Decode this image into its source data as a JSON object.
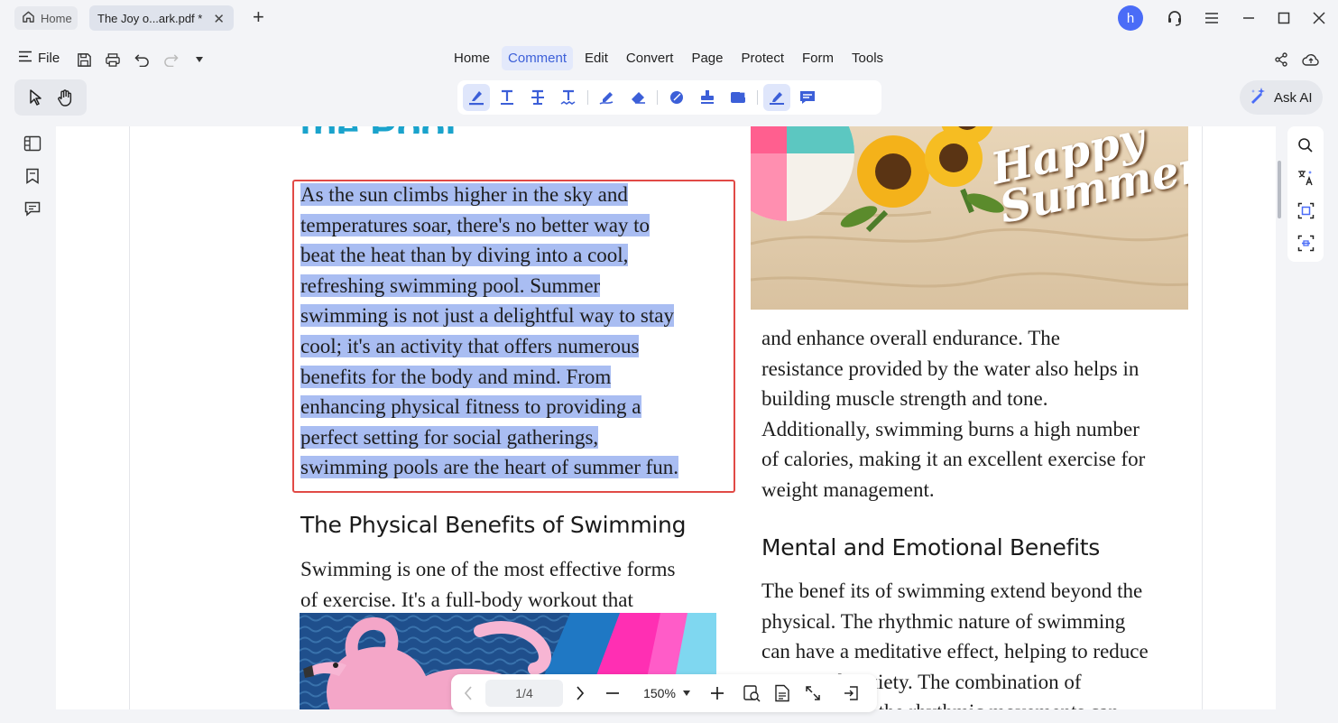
{
  "tabs": {
    "home_label": "Home",
    "doc_label": "The Joy o...ark.pdf *",
    "close_glyph": "✕",
    "new_tab_glyph": "+"
  },
  "user": {
    "avatar_letter": "h"
  },
  "menu": {
    "file_label": "File",
    "items": [
      "Home",
      "Comment",
      "Edit",
      "Convert",
      "Page",
      "Protect",
      "Form",
      "Tools"
    ],
    "active": "Comment"
  },
  "ask_ai": {
    "label": "Ask AI"
  },
  "document": {
    "title_fragment": "the Pool",
    "intro_lines": [
      "As the sun climbs higher in the sky and",
      "temperatures soar, there's no better way to",
      "beat the heat than by diving into a cool,",
      "refreshing swimming pool. Summer",
      "swimming is not just a delightful way to stay",
      "cool; it's an activity that offers numerous",
      "benefits for the body and mind. From",
      "enhancing physical fitness to providing a",
      "perfect setting for social gatherings,",
      "swimming pools are the heart of summer fun."
    ],
    "heading_physical": "The Physical Benefits of Swimming",
    "physical_lines": [
      "Swimming is one of the most effective forms",
      "of exercise. It's a full-body workout that"
    ],
    "endurance_lines": [
      "and enhance overall endurance. The",
      "resistance provided by the water also helps in",
      "building muscle strength and tone.",
      "Additionally, swimming burns a high number",
      "of calories, making it an excellent exercise for",
      "weight management."
    ],
    "heading_mental": "Mental and Emotional Benefits",
    "mental_lines": [
      "The benef  its of swimming extend beyond the",
      "physical. The rhythmic nature of swimming",
      "can have a meditative effect, helping to reduce",
      "stress and anxiety. The combination of",
      "the water and the rhythmic movements can"
    ],
    "image_text": "Happy Summer"
  },
  "nav": {
    "page_indicator": "1/4",
    "zoom": "150%"
  },
  "colors": {
    "accent": "#4a6cf7",
    "selection": "#a9bdf2",
    "selection_border": "#e14a46",
    "title_cyan": "#1aa3cc"
  }
}
